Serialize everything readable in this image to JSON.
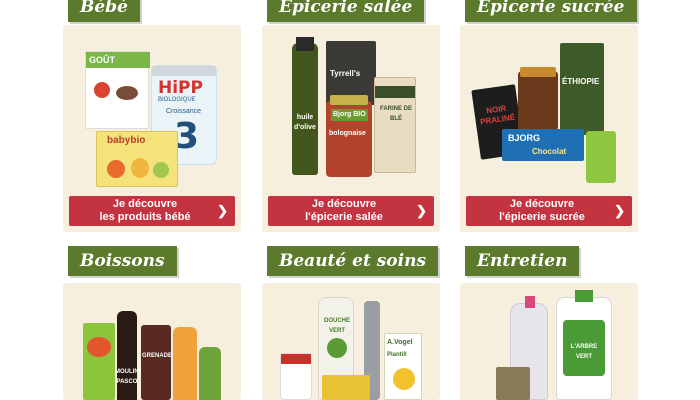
{
  "categories": [
    {
      "title": "Bébé",
      "cta_line1": "Je découvre",
      "cta_line2": "les produits bébé",
      "product_texts": [
        "GOÛT",
        "HiPP",
        "BIOLOGIQUE",
        "Croissance",
        "3",
        "babybio"
      ]
    },
    {
      "title": "Epicerie salée",
      "cta_line1": "Je découvre",
      "cta_line2": "l'épicerie salée",
      "product_texts": [
        "huile d'olive",
        "Tyrrell's",
        "Bjorg BIO",
        "bolognaise",
        "FARINE DE BLÉ"
      ]
    },
    {
      "title": "Epicerie sucrée",
      "cta_line1": "Je découvre",
      "cta_line2": "l'épicerie sucrée",
      "product_texts": [
        "NOIR PRALINÉ",
        "ÉTHIOPIE",
        "BJORG",
        "Chocolat"
      ]
    },
    {
      "title": "Boissons",
      "product_texts": [
        "MOULINS PASCO",
        "GRENADE"
      ]
    },
    {
      "title": "Beauté et soins",
      "product_texts": [
        "DOUCHE VERT",
        "A.Vogel",
        "Plantill"
      ]
    },
    {
      "title": "Entretien",
      "product_texts": [
        "L'ARBRE VERT"
      ]
    }
  ],
  "colors": {
    "tab": "#5b7a2b",
    "cta": "#c33340",
    "card": "#f7efdd"
  },
  "icons": {
    "cta_arrow": "chevron-right-icon"
  }
}
